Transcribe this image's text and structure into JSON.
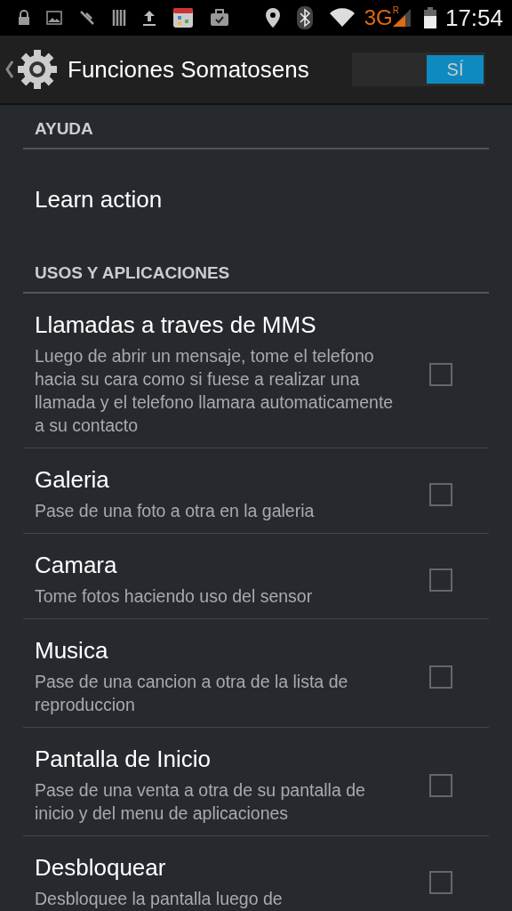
{
  "status_bar": {
    "network": "3G",
    "roaming": "R",
    "time": "17:54"
  },
  "action_bar": {
    "title": "Funciones Somatosens",
    "switch": {
      "label": "SÍ",
      "on": true
    }
  },
  "sections": [
    {
      "header": "AYUDA",
      "items": [
        {
          "kind": "action",
          "title": "Learn action"
        }
      ]
    },
    {
      "header": "USOS Y APLICACIONES",
      "items": [
        {
          "kind": "checkbox",
          "title": "Llamadas a traves de MMS",
          "summary": "Luego de abrir un mensaje, tome el telefono hacia su cara como si fuese a realizar una llamada y el telefono llamara automaticamente a su contacto",
          "checked": false
        },
        {
          "kind": "checkbox",
          "title": "Galeria",
          "summary": "Pase de una foto a otra en la galeria",
          "checked": false
        },
        {
          "kind": "checkbox",
          "title": "Camara",
          "summary": "Tome fotos haciendo uso del sensor",
          "checked": false
        },
        {
          "kind": "checkbox",
          "title": "Musica",
          "summary": "Pase de una cancion a otra de la lista de reproduccion",
          "checked": false
        },
        {
          "kind": "checkbox",
          "title": "Pantalla de Inicio",
          "summary": "Pase de una venta a otra de su pantalla de inicio y del menu de aplicaciones",
          "checked": false
        },
        {
          "kind": "checkbox",
          "title": "Desbloquear",
          "summary": "Desbloquee la pantalla luego de",
          "checked": false
        }
      ]
    }
  ]
}
